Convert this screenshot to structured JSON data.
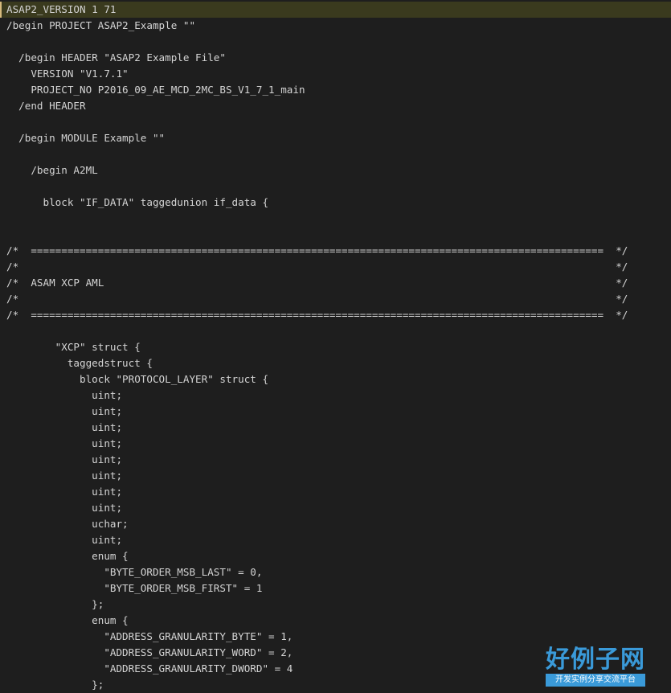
{
  "editor": {
    "lines": [
      "ASAP2_VERSION 1 71",
      "/begin PROJECT ASAP2_Example \"\"",
      "",
      "  /begin HEADER \"ASAP2 Example File\"",
      "    VERSION \"V1.7.1\"",
      "    PROJECT_NO P2016_09_AE_MCD_2MC_BS_V1_7_1_main",
      "  /end HEADER",
      "",
      "  /begin MODULE Example \"\"",
      "",
      "    /begin A2ML",
      "",
      "      block \"IF_DATA\" taggedunion if_data {",
      "",
      "",
      "/*  ==============================================================================================  */",
      "/*                                                                                                  */",
      "/*  ASAM XCP AML                                                                                    */",
      "/*                                                                                                  */",
      "/*  ==============================================================================================  */",
      "",
      "        \"XCP\" struct {",
      "          taggedstruct {",
      "            block \"PROTOCOL_LAYER\" struct {",
      "              uint;",
      "              uint;",
      "              uint;",
      "              uint;",
      "              uint;",
      "              uint;",
      "              uint;",
      "              uint;",
      "              uchar;",
      "              uint;",
      "              enum {",
      "                \"BYTE_ORDER_MSB_LAST\" = 0,",
      "                \"BYTE_ORDER_MSB_FIRST\" = 1",
      "              };",
      "              enum {",
      "                \"ADDRESS_GRANULARITY_BYTE\" = 1,",
      "                \"ADDRESS_GRANULARITY_WORD\" = 2,",
      "                \"ADDRESS_GRANULARITY_DWORD\" = 4",
      "              };"
    ]
  },
  "watermark": {
    "main": "好例子网",
    "sub": "开发实例分享交流平台"
  },
  "colors": {
    "background": "#1e1e1e",
    "text": "#d4d4d4",
    "current_line": "#3a3a1e",
    "watermark": "#3a9ad9"
  }
}
